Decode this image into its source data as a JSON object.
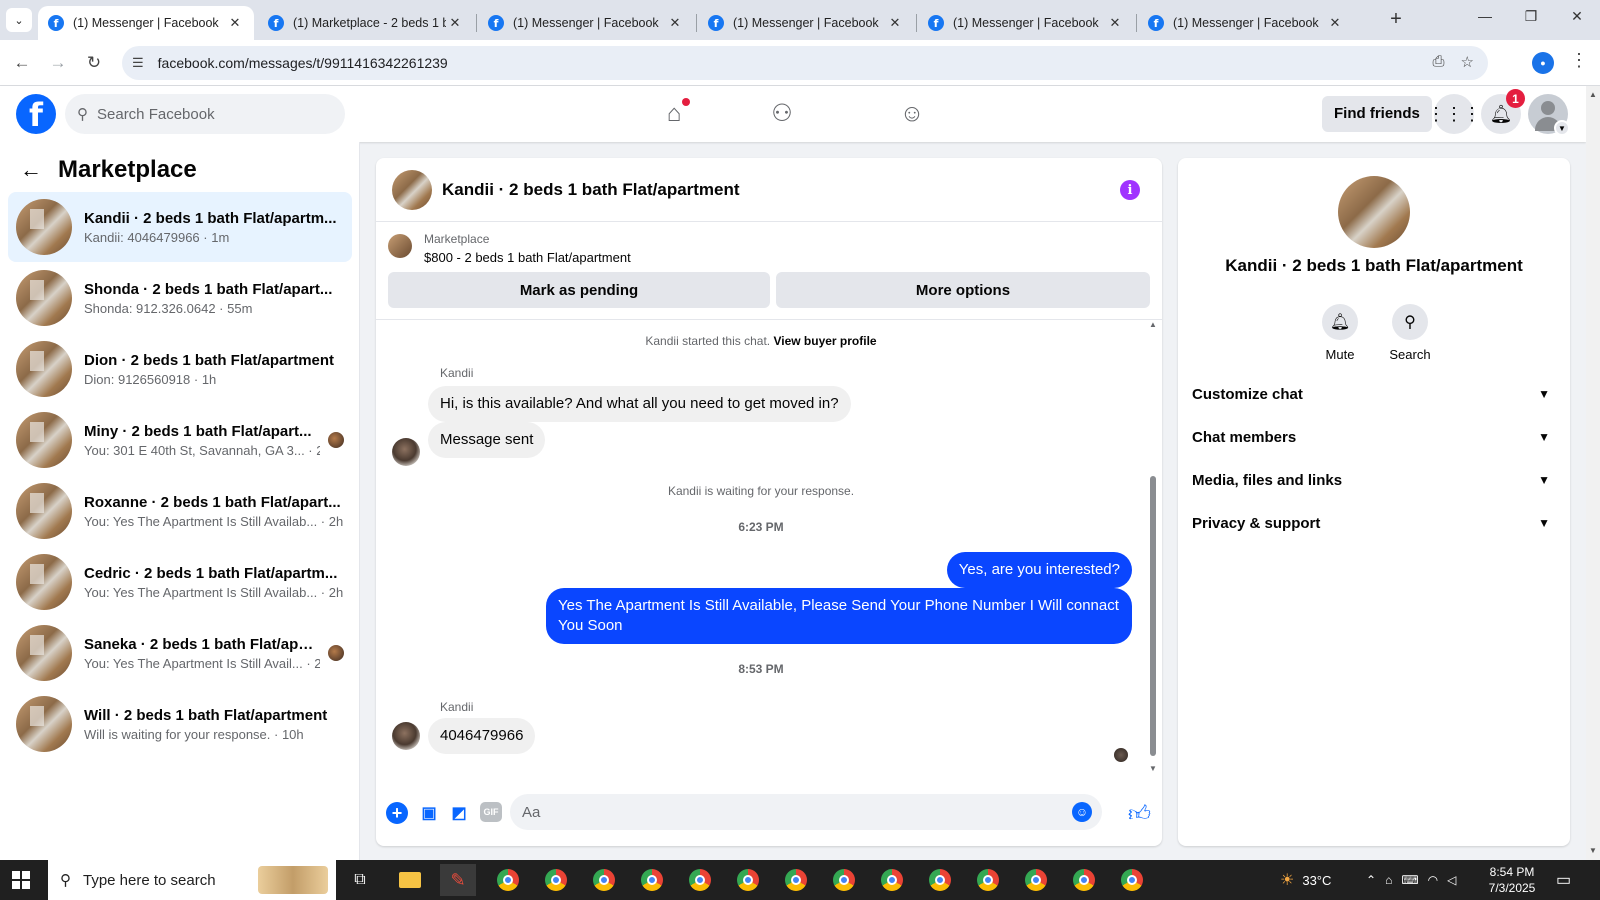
{
  "browser": {
    "tabs": [
      {
        "label": "(1) Messenger | Facebook",
        "active": true
      },
      {
        "label": "(1) Marketplace - 2 beds 1 ba",
        "active": false
      },
      {
        "label": "(1) Messenger | Facebook",
        "active": false
      },
      {
        "label": "(1) Messenger | Facebook",
        "active": false
      },
      {
        "label": "(1) Messenger | Facebook",
        "active": false
      },
      {
        "label": "(1) Messenger | Facebook",
        "active": false
      }
    ],
    "url": "facebook.com/messages/t/9911416342261239"
  },
  "fb": {
    "search_placeholder": "Search Facebook",
    "find_friends": "Find friends",
    "notification_count": "1"
  },
  "sidebar": {
    "title": "Marketplace",
    "conversations": [
      {
        "name": "Kandii · 2 beds 1 bath Flat/apartm...",
        "sub": "Kandii: 4046479966 · 1m",
        "active": true,
        "seen": false
      },
      {
        "name": "Shonda · 2 beds 1 bath Flat/apart...",
        "sub": "Shonda: 912.326.0642 · 55m",
        "active": false,
        "seen": false
      },
      {
        "name": "Dion · 2 beds 1 bath Flat/apartment",
        "sub": "Dion: 9126560918 · 1h",
        "active": false,
        "seen": false
      },
      {
        "name": "Miny · 2 beds 1 bath Flat/apart...",
        "sub": "You: 301 E 40th St, Savannah, GA 3... · 2h",
        "active": false,
        "seen": true
      },
      {
        "name": "Roxanne · 2 beds 1 bath Flat/apart...",
        "sub": "You: Yes The Apartment Is Still Availab... · 2h",
        "active": false,
        "seen": false
      },
      {
        "name": "Cedric · 2 beds 1 bath Flat/apartm...",
        "sub": "You: Yes The Apartment Is Still Availab... · 2h",
        "active": false,
        "seen": false
      },
      {
        "name": "Saneka · 2 beds 1 bath Flat/apar...",
        "sub": "You: Yes The Apartment Is Still Avail... · 2h",
        "active": false,
        "seen": true
      },
      {
        "name": "Will · 2 beds 1 bath Flat/apartment",
        "sub": "Will is waiting for your response. · 10h",
        "active": false,
        "seen": false
      }
    ]
  },
  "chat": {
    "title": "Kandii · 2 beds 1 bath Flat/apartment",
    "listing_source": "Marketplace",
    "listing_price": "$800 - 2 beds 1 bath Flat/apartment",
    "mark_pending": "Mark as pending",
    "more_options": "More options",
    "started_text": "Kandii started this chat.",
    "view_buyer": "View buyer profile",
    "sender_name": "Kandii",
    "msg_in_1": "Hi, is this available? And what all you need to get moved in?",
    "msg_in_2": "Message sent",
    "waiting_text": "Kandii is waiting for your response.",
    "time_1": "6:23 PM",
    "msg_out_1": "Yes, are you interested?",
    "msg_out_2": "Yes The Apartment Is Still Available, Please Send Your Phone Number I Will connact You Soon",
    "time_2": "8:53 PM",
    "sender_name_2": "Kandii",
    "msg_in_3": "4046479966",
    "composer_placeholder": "Aa"
  },
  "info": {
    "title": "Kandii · 2 beds 1 bath Flat/apartment",
    "mute": "Mute",
    "search": "Search",
    "sections": [
      "Customize chat",
      "Chat members",
      "Media, files and links",
      "Privacy & support"
    ]
  },
  "taskbar": {
    "search_placeholder": "Type here to search",
    "temperature": "33°C",
    "time": "8:54 PM",
    "date": "7/3/2025"
  },
  "colors": {
    "accent": "#0866ff",
    "outgoing_bubble": "#0a46ff",
    "active_row": "#e7f3ff",
    "info_icon": "#a033ff"
  }
}
